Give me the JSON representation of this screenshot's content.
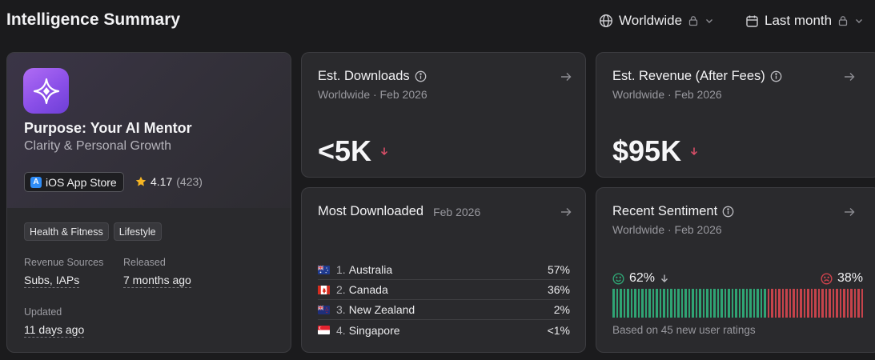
{
  "header": {
    "title": "Intelligence Summary",
    "region_filter": {
      "icon": "globe-icon",
      "label": "Worldwide"
    },
    "period_filter": {
      "icon": "calendar-icon",
      "label": "Last month"
    }
  },
  "app": {
    "name": "Purpose: Your AI Mentor",
    "subtitle": "Clarity & Personal Growth",
    "store": "iOS App Store",
    "rating": "4.17",
    "rating_count": "(423)",
    "tags": [
      "Health & Fitness",
      "Lifestyle"
    ],
    "revenue_sources_label": "Revenue Sources",
    "revenue_sources": "Subs, IAPs",
    "released_label": "Released",
    "released": "7 months ago",
    "updated_label": "Updated",
    "updated": "11 days ago",
    "colors": {
      "icon_start": "#b06cf4",
      "icon_end": "#6d3fd6"
    }
  },
  "downloads": {
    "title": "Est. Downloads",
    "subtitle": "Worldwide · Feb 2026",
    "value": "<5K",
    "trend": "down"
  },
  "revenue": {
    "title": "Est. Revenue (After Fees)",
    "subtitle": "Worldwide · Feb 2026",
    "value": "$95K",
    "trend": "down"
  },
  "most_downloaded": {
    "title": "Most Downloaded",
    "date": "Feb 2026",
    "rows": [
      {
        "rank": "1.",
        "country": "Australia",
        "pct": "57%",
        "flag": "au-flag"
      },
      {
        "rank": "2.",
        "country": "Canada",
        "pct": "36%",
        "flag": "ca-flag"
      },
      {
        "rank": "3.",
        "country": "New Zealand",
        "pct": "2%",
        "flag": "nz-flag"
      },
      {
        "rank": "4.",
        "country": "Singapore",
        "pct": "<1%",
        "flag": "sg-flag"
      }
    ]
  },
  "sentiment": {
    "title": "Recent Sentiment",
    "subtitle": "Worldwide · Feb 2026",
    "positive_pct": "62%",
    "negative_pct": "38%",
    "positive_share": 0.62,
    "footer": "Based on 45 new user ratings",
    "colors": {
      "positive": "#2fa474",
      "negative": "#c6434b",
      "trend_down": "#e0506a"
    }
  }
}
